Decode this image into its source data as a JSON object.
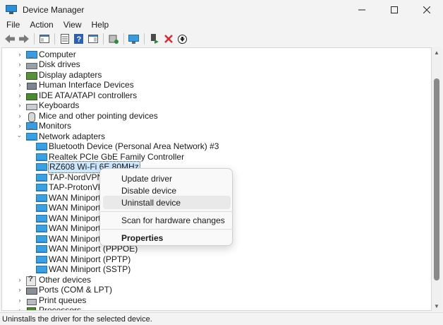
{
  "window": {
    "title": "Device Manager",
    "controls": [
      "minimize-icon",
      "maximize-icon",
      "close-icon"
    ]
  },
  "menu": [
    "File",
    "Action",
    "View",
    "Help"
  ],
  "toolbar": {
    "buttons": [
      "back-arrow-icon",
      "forward-arrow-icon",
      "show-hide-console-tree-icon",
      "properties-icon",
      "help-icon",
      "show-action-pane-icon",
      "update-driver-icon",
      "scan-hardware-icon",
      "enable-device-icon",
      "uninstall-device-icon",
      "download-driver-icon"
    ]
  },
  "tree": {
    "categories": [
      {
        "label": "Computer",
        "icon": "computer-icon",
        "expanded": false
      },
      {
        "label": "Disk drives",
        "icon": "disk-drive-icon",
        "expanded": false
      },
      {
        "label": "Display adapters",
        "icon": "display-adapter-icon",
        "expanded": false
      },
      {
        "label": "Human Interface Devices",
        "icon": "hid-icon",
        "expanded": false
      },
      {
        "label": "IDE ATA/ATAPI controllers",
        "icon": "ide-controller-icon",
        "expanded": false
      },
      {
        "label": "Keyboards",
        "icon": "keyboard-icon",
        "expanded": false
      },
      {
        "label": "Mice and other pointing devices",
        "icon": "mouse-icon",
        "expanded": false
      },
      {
        "label": "Monitors",
        "icon": "monitor-icon",
        "expanded": false
      },
      {
        "label": "Network adapters",
        "icon": "network-adapter-icon",
        "expanded": true
      },
      {
        "label": "Other devices",
        "icon": "other-devices-icon",
        "expanded": false
      },
      {
        "label": "Ports (COM & LPT)",
        "icon": "ports-icon",
        "expanded": false
      },
      {
        "label": "Print queues",
        "icon": "print-queue-icon",
        "expanded": false
      },
      {
        "label": "Processors",
        "icon": "processor-icon",
        "expanded": false
      }
    ],
    "network_adapters": [
      "Bluetooth Device (Personal Area Network) #3",
      "Realtek PCIe GbE Family Controller",
      "RZ608 Wi-Fi 6E 80MHz",
      "TAP-NordVPN Wi",
      "TAP-ProtonVPN W",
      "WAN Miniport (IK",
      "WAN Miniport (IP",
      "WAN Miniport (IP",
      "WAN Miniport (L2",
      "WAN Miniport (N",
      "WAN Miniport (PPPOE)",
      "WAN Miniport (PPTP)",
      "WAN Miniport (SSTP)"
    ],
    "selected_index": 2
  },
  "context_menu": {
    "items": [
      {
        "label": "Update driver",
        "bold": false,
        "hover": false
      },
      {
        "label": "Disable device",
        "bold": false,
        "hover": false
      },
      {
        "label": "Uninstall device",
        "bold": false,
        "hover": true
      },
      {
        "label": "Scan for hardware changes",
        "bold": false,
        "hover": false
      },
      {
        "label": "Properties",
        "bold": true,
        "hover": false
      }
    ]
  },
  "status": {
    "text": "Uninstalls the driver for the selected device."
  },
  "colors": {
    "selection": "#cce8ff",
    "menu_hover": "#e9e9e9",
    "uninstall_red": "#d9282f",
    "enable_green": "#2e8b3e"
  }
}
